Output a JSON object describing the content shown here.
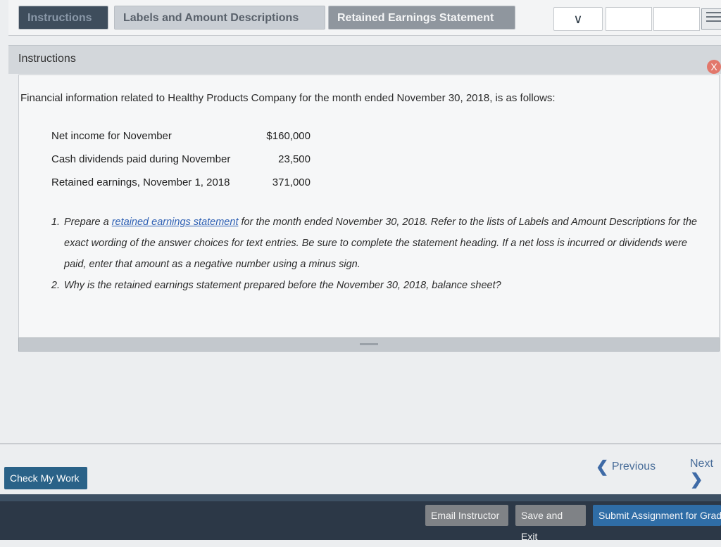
{
  "tabs": {
    "instructions": "Instructions",
    "labels": "Labels and Amount Descriptions",
    "retained": "Retained Earnings Statement"
  },
  "dropdown": {
    "icon": "chevron-down-icon",
    "glyph": "∨"
  },
  "panel": {
    "title": "Instructions",
    "close": "X",
    "intro": "Financial information related to Healthy Products Company for the month ended November 30, 2018, is as follows:",
    "rows": [
      {
        "label": "Net income for November",
        "value": "$160,000"
      },
      {
        "label": "Cash dividends paid during November",
        "value": "23,500"
      },
      {
        "label": "Retained earnings, November 1, 2018",
        "value": "371,000"
      }
    ],
    "q1_pre": "Prepare a ",
    "q1_link": "retained earnings statement",
    "q1_post": " for the month ended November 30, 2018. Refer to the lists of Labels and Amount Descriptions for the exact wording of the answer choices for text entries. Be sure to complete the statement heading. If a net loss is incurred or dividends were paid, enter that amount as a negative number using a minus sign.",
    "q2": "Why is the retained earnings statement prepared before the November 30, 2018, balance sheet?"
  },
  "nav": {
    "previous": "Previous",
    "next": "Next",
    "check": "Check My Work"
  },
  "footer": {
    "email": "Email Instructor",
    "save": "Save and Exit",
    "submit": "Submit Assignment for Grading"
  }
}
